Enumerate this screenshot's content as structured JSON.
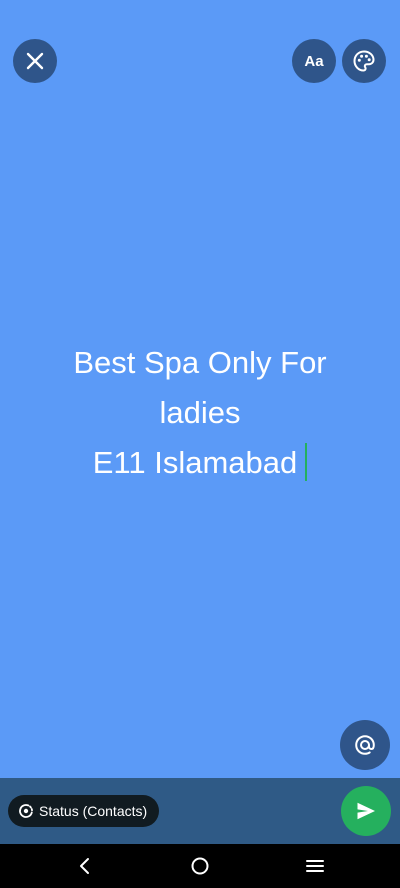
{
  "colors": {
    "canvas_bg": "#5b9af7",
    "button_bg": "#2f558a",
    "bottom_bar_bg": "#2f5a86",
    "chip_bg": "#111b21",
    "send_bg": "#25b05e",
    "caret": "#25b05e",
    "nav_bg": "#000000",
    "nav_icon": "#ffffff"
  },
  "toolbar": {
    "close_icon": "close-icon",
    "font_label": "Aa",
    "palette_icon": "palette-icon"
  },
  "status": {
    "lines": [
      "Best Spa Only For",
      "ladies",
      "E11 Islamabad"
    ]
  },
  "mention": {
    "icon": "at-icon"
  },
  "footer": {
    "audience_label": "Status (Contacts)",
    "send_icon": "send-icon"
  },
  "nav": {
    "back_icon": "back-icon",
    "home_icon": "home-icon",
    "menu_icon": "menu-icon"
  }
}
